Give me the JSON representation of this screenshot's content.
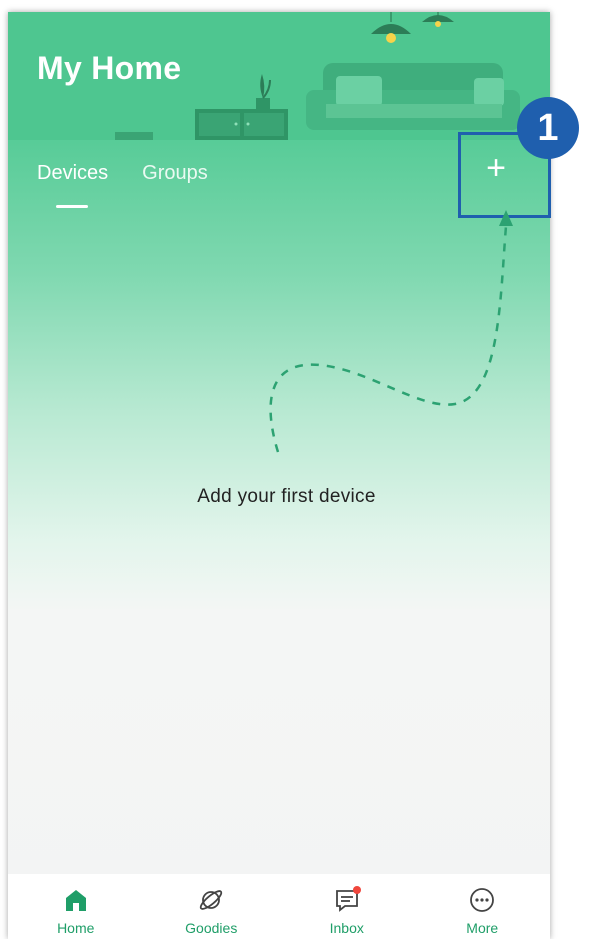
{
  "header": {
    "title": "My Home"
  },
  "tabs": [
    {
      "label": "Devices",
      "active": true
    },
    {
      "label": "Groups",
      "active": false
    }
  ],
  "add_button": {
    "symbol": "+"
  },
  "step_badge": "1",
  "empty_state": {
    "text": "Add your first device"
  },
  "tabbar": [
    {
      "label": "Home",
      "icon": "home-icon",
      "active": true
    },
    {
      "label": "Goodies",
      "icon": "planet-icon",
      "active": false
    },
    {
      "label": "Inbox",
      "icon": "message-icon",
      "has_notification": true
    },
    {
      "label": "More",
      "icon": "more-icon",
      "active": false
    }
  ],
  "colors": {
    "header_green": "#4ec690",
    "accent_green": "#1f9e68",
    "highlight_blue": "#1f5fae",
    "notification_red": "#f0463c"
  }
}
